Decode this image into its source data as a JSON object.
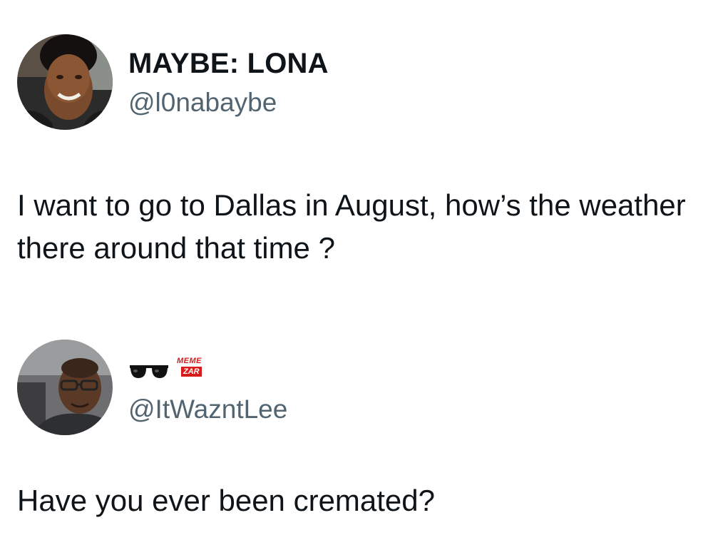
{
  "tweets": [
    {
      "display_name": "MAYBE: LONA",
      "handle": "@l0nabaybe",
      "text": "I want to go to Dallas in August, how’s the weather there around that time ?",
      "avatar_icon": "user-avatar-woman"
    },
    {
      "display_name_icon": "sunglasses-icon",
      "handle": "@ItWazntLee",
      "text": "Have you ever been cremated?",
      "avatar_icon": "user-avatar-man"
    }
  ],
  "watermark": {
    "line1": "MEME",
    "line2": "ZAR",
    "color": "#d81b1b"
  },
  "colors": {
    "text": "#0f1419",
    "handle": "#536471",
    "background": "#ffffff"
  }
}
